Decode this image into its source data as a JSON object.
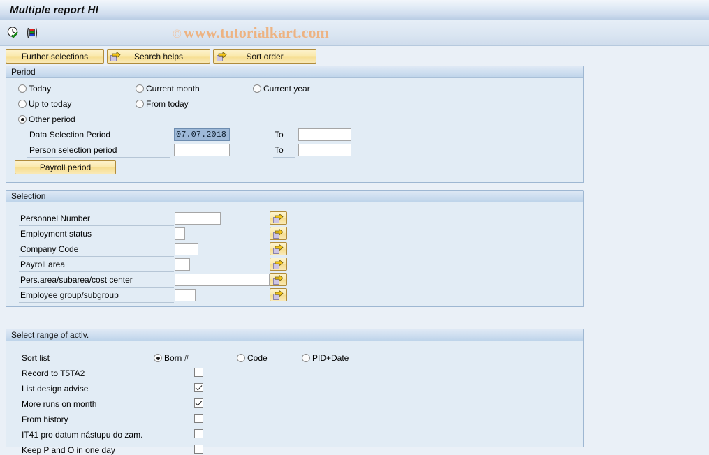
{
  "window": {
    "title": "Multiple report HI"
  },
  "toolbar": {
    "icons": [
      {
        "name": "execute-with-check-icon",
        "label": "Execute"
      },
      {
        "name": "variant-bars-icon",
        "label": "Get Variant"
      }
    ],
    "watermark": {
      "copyright": "©",
      "text": "www.tutorialkart.com"
    }
  },
  "buttons": [
    {
      "name": "further-selections-button",
      "label": "Further selections",
      "icon": null
    },
    {
      "name": "search-helps-button",
      "label": "Search helps",
      "icon": "arrow-right-icon"
    },
    {
      "name": "sort-order-button",
      "label": "Sort order",
      "icon": "arrow-right-icon"
    }
  ],
  "period": {
    "header": "Period",
    "radios": [
      {
        "label": "Today",
        "selected": false
      },
      {
        "label": "Current month",
        "selected": false
      },
      {
        "label": "Current year",
        "selected": false
      },
      {
        "label": "Up to today",
        "selected": false
      },
      {
        "label": "From today",
        "selected": false
      },
      {
        "label": "Other period",
        "selected": true
      }
    ],
    "rows": [
      {
        "label": "Data Selection Period",
        "value": "07.07.2018",
        "selected": true,
        "to_label": "To",
        "to_value": ""
      },
      {
        "label": "Person selection period",
        "value": "",
        "selected": false,
        "to_label": "To",
        "to_value": ""
      }
    ],
    "payroll_button": "Payroll period"
  },
  "selection": {
    "header": "Selection",
    "rows": [
      {
        "label": "Personnel Number",
        "value": "",
        "field_width": 66
      },
      {
        "label": "Employment status",
        "value": "",
        "field_width": 15
      },
      {
        "label": "Company Code",
        "value": "",
        "field_width": 34
      },
      {
        "label": "Payroll area",
        "value": "",
        "field_width": 22
      },
      {
        "label": "Pers.area/subarea/cost center",
        "value": "",
        "field_width": 136
      },
      {
        "label": "Employee group/subgroup",
        "value": "",
        "field_width": 30
      }
    ],
    "multi_select_name": "multiple-selection-button"
  },
  "activities": {
    "header": "Select range of activ.",
    "sort_list": {
      "label": "Sort list",
      "options": [
        {
          "label": "Born #",
          "selected": true
        },
        {
          "label": "Code",
          "selected": false
        },
        {
          "label": "PID+Date",
          "selected": false
        }
      ]
    },
    "checkboxes": [
      {
        "label": "Record to T5TA2",
        "checked": false
      },
      {
        "label": "List design advise",
        "checked": true
      },
      {
        "label": "More runs on month",
        "checked": true
      },
      {
        "label": "From history",
        "checked": false
      },
      {
        "label": "IT41 pro datum nástupu do zam.",
        "checked": false
      },
      {
        "label": "Keep P and O in one day",
        "checked": false
      }
    ]
  },
  "colors": {
    "window_bg": "#eaf0f7",
    "panel_bg": "#e2ecf5",
    "panel_border": "#9eb7d2",
    "button_yellow": "#fae9ad",
    "button_border": "#b08c3c",
    "watermark": "#edb382",
    "field_selected_bg": "#9eb9d8"
  }
}
